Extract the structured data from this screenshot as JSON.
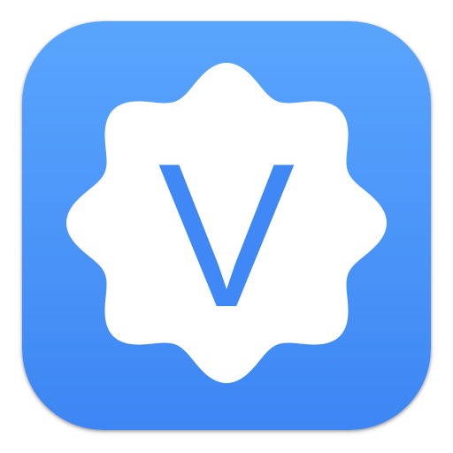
{
  "app_icon": {
    "letter": "V",
    "colors": {
      "gradient_top": "#59a5fd",
      "gradient_bottom": "#3d86f4",
      "badge": "#ffffff",
      "letter": "#3f88f5"
    },
    "icons": {
      "shape": "scalloped-badge-icon"
    }
  }
}
